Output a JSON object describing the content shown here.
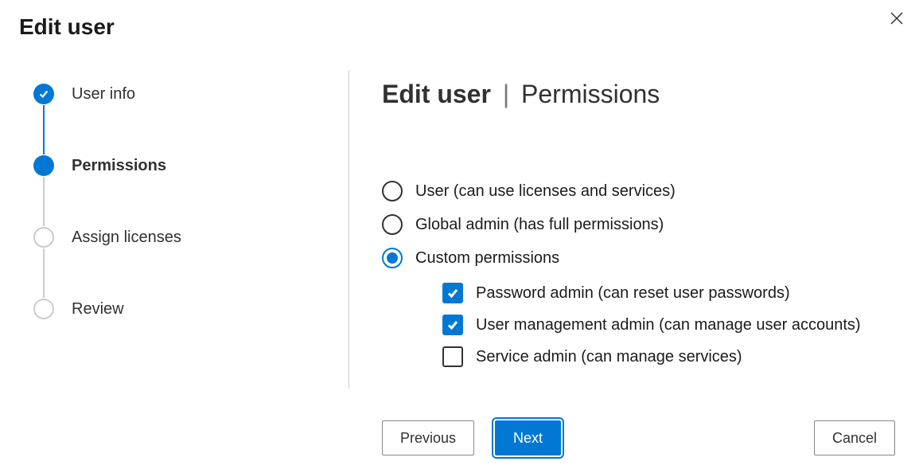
{
  "dialog": {
    "title": "Edit user"
  },
  "stepper": {
    "steps": [
      {
        "label": "User info",
        "state": "completed"
      },
      {
        "label": "Permissions",
        "state": "current"
      },
      {
        "label": "Assign licenses",
        "state": "upcoming"
      },
      {
        "label": "Review",
        "state": "upcoming"
      }
    ]
  },
  "main": {
    "heading_bold": "Edit user",
    "heading_separator": "|",
    "heading_rest": "Permissions",
    "radios": [
      {
        "label": "User (can use licenses and services)",
        "checked": false
      },
      {
        "label": "Global admin (has full permissions)",
        "checked": false
      },
      {
        "label": "Custom permissions",
        "checked": true
      }
    ],
    "custom_permissions": [
      {
        "label": "Password admin (can reset user passwords)",
        "checked": true
      },
      {
        "label": "User management admin (can manage user accounts)",
        "checked": true
      },
      {
        "label": "Service admin (can manage services)",
        "checked": false
      }
    ]
  },
  "footer": {
    "previous": "Previous",
    "next": "Next",
    "cancel": "Cancel"
  }
}
